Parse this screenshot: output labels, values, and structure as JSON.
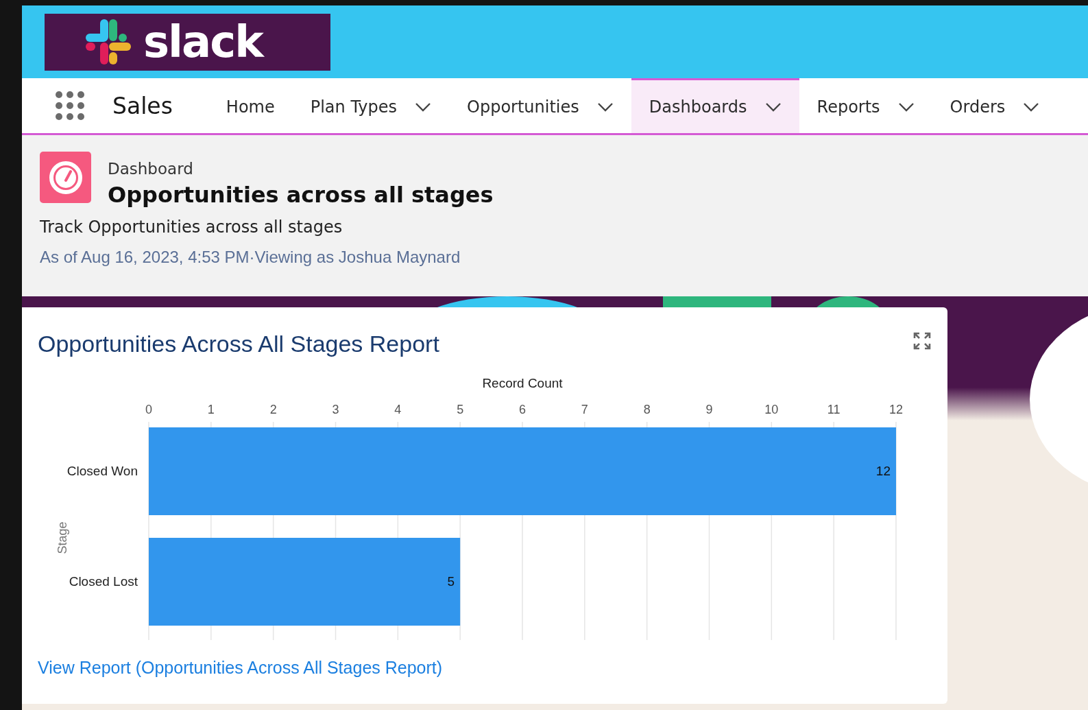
{
  "logo": {
    "text": "slack"
  },
  "nav": {
    "app_name": "Sales",
    "items": [
      {
        "label": "Home",
        "dropdown": false,
        "selected": false
      },
      {
        "label": "Plan Types",
        "dropdown": true,
        "selected": false
      },
      {
        "label": "Opportunities",
        "dropdown": true,
        "selected": false
      },
      {
        "label": "Dashboards",
        "dropdown": true,
        "selected": true
      },
      {
        "label": "Reports",
        "dropdown": true,
        "selected": false
      },
      {
        "label": "Orders",
        "dropdown": true,
        "selected": false
      }
    ]
  },
  "header": {
    "type_label": "Dashboard",
    "title": "Opportunities across all stages",
    "description": "Track Opportunities across all stages",
    "meta": "As of Aug 16, 2023, 4:53 PM·Viewing as Joshua Maynard"
  },
  "card": {
    "title": "Opportunities Across All Stages Report",
    "chart_data": {
      "type": "bar",
      "orientation": "horizontal",
      "xlabel": "Record Count",
      "ylabel": "Stage",
      "categories": [
        "Closed Won",
        "Closed Lost"
      ],
      "values": [
        12,
        5
      ],
      "xlim": [
        0,
        12
      ],
      "xticks": [
        0,
        1,
        2,
        3,
        4,
        5,
        6,
        7,
        8,
        9,
        10,
        11,
        12
      ],
      "grid": true,
      "data_labels": true
    },
    "link": "View Report (Opportunities Across All Stages Report)"
  }
}
